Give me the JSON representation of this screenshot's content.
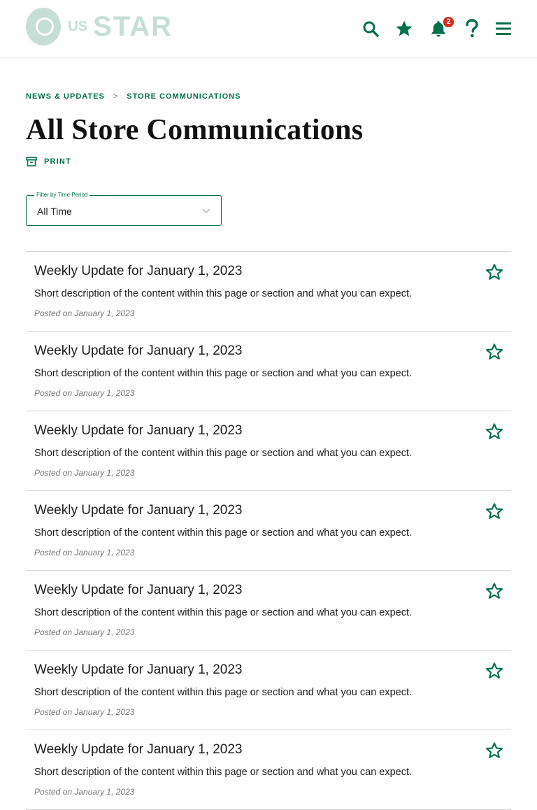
{
  "header": {
    "logo": {
      "prefix": "US",
      "name": "STAR"
    },
    "icons": [
      {
        "name": "search-icon"
      },
      {
        "name": "star-icon"
      },
      {
        "name": "bell-icon",
        "badge": "2"
      },
      {
        "name": "help-icon"
      },
      {
        "name": "menu-icon"
      }
    ]
  },
  "breadcrumb": {
    "parent": "NEWS & UPDATES",
    "separator": ">",
    "current": "STORE COMMUNICATIONS"
  },
  "page": {
    "title": "All Store Communications",
    "print_label": "PRINT"
  },
  "filter": {
    "legend": "Filter by Time Period",
    "value": "All Time"
  },
  "items": [
    {
      "title": "Weekly Update for January 1, 2023",
      "description": "Short description of the content within this page or section and what you can expect.",
      "posted": "Posted on January 1, 2023"
    },
    {
      "title": "Weekly Update for January 1, 2023",
      "description": "Short description of the content within this page or section and what you can expect.",
      "posted": "Posted on January 1, 2023"
    },
    {
      "title": "Weekly Update for January 1, 2023",
      "description": "Short description of the content within this page or section and what you can expect.",
      "posted": "Posted on January 1, 2023"
    },
    {
      "title": "Weekly Update for January 1, 2023",
      "description": "Short description of the content within this page or section and what you can expect.",
      "posted": "Posted on January 1, 2023"
    },
    {
      "title": "Weekly Update for January 1, 2023",
      "description": "Short description of the content within this page or section and what you can expect.",
      "posted": "Posted on January 1, 2023"
    },
    {
      "title": "Weekly Update for January 1, 2023",
      "description": "Short description of the content within this page or section and what you can expect.",
      "posted": "Posted on January 1, 2023"
    },
    {
      "title": "Weekly Update for January 1, 2023",
      "description": "Short description of the content within this page or section and what you can expect.",
      "posted": "Posted on January 1, 2023"
    }
  ],
  "colors": {
    "brand": "#00704a",
    "badge": "#d62b1f",
    "divider": "#d6d6d6"
  }
}
